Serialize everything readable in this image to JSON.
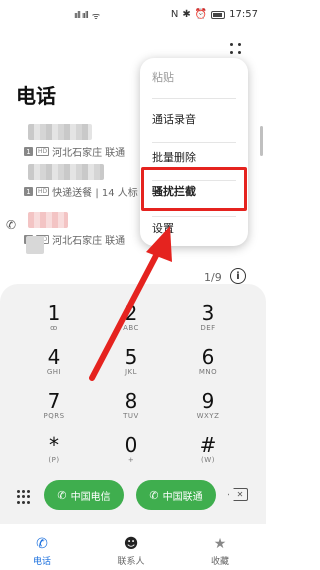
{
  "status_bar": {
    "time": "17:57",
    "left_signal": "ııll ııll",
    "wifi": "ᯤ",
    "nfc": "N",
    "bt": "✱",
    "alarm": "⏰"
  },
  "page_title": "电话",
  "call_log": [
    {
      "location": "河北石家庄",
      "carrier": "联通"
    },
    {
      "location": "快递送餐 | 14 人标",
      "carrier": ""
    },
    {
      "location": "河北石家庄",
      "carrier": "联通"
    }
  ],
  "page_indicator": "1/9",
  "info_icon_label": "i",
  "menu": {
    "items": [
      "粘贴",
      "通话录音",
      "批量删除",
      "骚扰拦截",
      "设置"
    ],
    "highlighted_index": 3,
    "highlight_color": "#e5231f"
  },
  "dialpad": {
    "keys": [
      {
        "digit": "1",
        "letters": "ꝏ"
      },
      {
        "digit": "2",
        "letters": "ABC"
      },
      {
        "digit": "3",
        "letters": "DEF"
      },
      {
        "digit": "4",
        "letters": "GHI"
      },
      {
        "digit": "5",
        "letters": "JKL"
      },
      {
        "digit": "6",
        "letters": "MNO"
      },
      {
        "digit": "7",
        "letters": "PQRS"
      },
      {
        "digit": "8",
        "letters": "TUV"
      },
      {
        "digit": "9",
        "letters": "WXYZ"
      },
      {
        "digit": "*",
        "letters": "(P)"
      },
      {
        "digit": "0",
        "letters": "+"
      },
      {
        "digit": "#",
        "letters": "(W)"
      }
    ],
    "call_buttons": [
      {
        "label": "中国电信",
        "sim": "1"
      },
      {
        "label": "中国联通",
        "sim": "2"
      }
    ],
    "call_button_color": "#3fae4e"
  },
  "bottom_nav": [
    {
      "label": "电话",
      "icon": "phone-icon",
      "active": true
    },
    {
      "label": "联系人",
      "icon": "contacts-icon",
      "active": false
    },
    {
      "label": "收藏",
      "icon": "star-icon",
      "active": false
    }
  ],
  "accent_color": "#1a6fde"
}
